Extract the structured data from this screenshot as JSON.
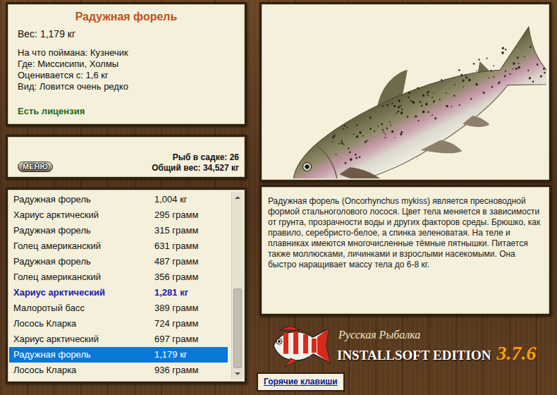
{
  "fish_card": {
    "title": "Радужная форель",
    "weight": "Вес: 1,179 кг",
    "details": [
      "На что поймана: Кузнечик",
      "Где: Миссисипи, Холмы",
      "Оценивается с: 1,6 кг",
      "Вид: Ловится очень редко"
    ],
    "license": "Есть лицензия"
  },
  "keepnet": {
    "menu_button": "МЕНЮ",
    "count": "Рыб в садке: 26",
    "total": "Общий вес: 34,527 кг"
  },
  "catch_list": {
    "rows": [
      {
        "name": "Радужная форель",
        "weight": "1,004 кг",
        "highlighted": false,
        "selected": false
      },
      {
        "name": "Хариус арктический",
        "weight": "295 грамм",
        "highlighted": false,
        "selected": false
      },
      {
        "name": "Радужная форель",
        "weight": "315 грамм",
        "highlighted": false,
        "selected": false
      },
      {
        "name": "Голец американский",
        "weight": "631 грамм",
        "highlighted": false,
        "selected": false
      },
      {
        "name": "Радужная форель",
        "weight": "487 грамм",
        "highlighted": false,
        "selected": false
      },
      {
        "name": "Голец американский",
        "weight": "356 грамм",
        "highlighted": false,
        "selected": false
      },
      {
        "name": "Хариус арктический",
        "weight": "1,281 кг",
        "highlighted": true,
        "selected": false
      },
      {
        "name": "Малоротый басс",
        "weight": "389 грамм",
        "highlighted": false,
        "selected": false
      },
      {
        "name": "Лосось Кларка",
        "weight": "724 грамм",
        "highlighted": false,
        "selected": false
      },
      {
        "name": "Хариус арктический",
        "weight": "697 грамм",
        "highlighted": false,
        "selected": false
      },
      {
        "name": "Радужная форель",
        "weight": "1,179 кг",
        "highlighted": false,
        "selected": true
      },
      {
        "name": "Лосось Кларка",
        "weight": "936 грамм",
        "highlighted": false,
        "selected": false
      }
    ],
    "scrollbar": {
      "level": 0.48,
      "at_end": true
    }
  },
  "description": "Радужная форель (Oncorhynchus mykiss) является пресноводной формой стальноголового лосося. Цвет тела меняется в зависимости от грунта, прозрачности воды и других факторов среды. Брюшко, как правило, серебристо-белое, а спинка зеленоватая. На теле и плавниках имеются многочисленные тёмные пятнышки. Питается также моллюсками, личинками и взрослыми насекомыми. Она быстро наращивает массу тела до 6-8 кг.",
  "logo": {
    "title": "Русская Рыбалка",
    "edition": "INSTALLSOFT EDITION",
    "version": "3.7.6"
  },
  "hotkeys_link": "Горячие клавиши"
}
